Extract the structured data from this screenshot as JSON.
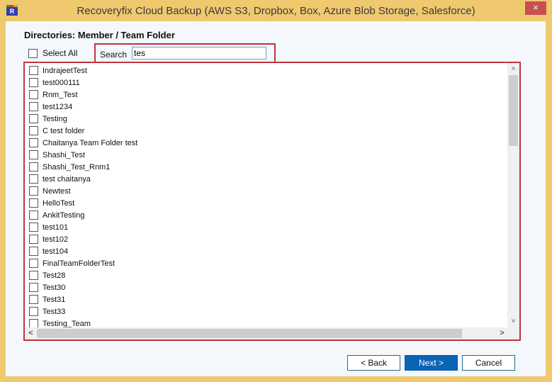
{
  "window": {
    "title": "Recoveryfix Cloud Backup (AWS S3, Dropbox, Box, Azure Blob Storage, Salesforce)",
    "app_icon_letter": "R",
    "close_glyph": "×"
  },
  "heading": "Directories: Member / Team Folder",
  "select_all": {
    "label": "Select All",
    "checked": false
  },
  "search": {
    "label": "Search",
    "value": "tes",
    "placeholder": ""
  },
  "items": [
    {
      "label": "IndrajeetTest",
      "checked": false
    },
    {
      "label": "test000111",
      "checked": false
    },
    {
      "label": "Rnm_Test",
      "checked": false
    },
    {
      "label": "test1234",
      "checked": false
    },
    {
      "label": "Testing",
      "checked": false
    },
    {
      "label": "C test folder",
      "checked": false
    },
    {
      "label": "Chaitanya Team Folder test",
      "checked": false
    },
    {
      "label": "Shashi_Test",
      "checked": false
    },
    {
      "label": "Shashi_Test_Rnm1",
      "checked": false
    },
    {
      "label": "test chaitanya",
      "checked": false
    },
    {
      "label": "Newtest",
      "checked": false
    },
    {
      "label": "HelloTest",
      "checked": false
    },
    {
      "label": "AnkitTesting",
      "checked": false
    },
    {
      "label": "test101",
      "checked": false
    },
    {
      "label": "test102",
      "checked": false
    },
    {
      "label": "test104",
      "checked": false
    },
    {
      "label": "FinalTeamFolderTest",
      "checked": false
    },
    {
      "label": "Test28",
      "checked": false
    },
    {
      "label": "Test30",
      "checked": false
    },
    {
      "label": "Test31",
      "checked": false
    },
    {
      "label": "Test33",
      "checked": false
    },
    {
      "label": "Testing_Team",
      "checked": false
    }
  ],
  "scroll": {
    "up_glyph": "˄",
    "down_glyph": "˅",
    "left_glyph": "<",
    "right_glyph": ">"
  },
  "buttons": {
    "back": "< Back",
    "next": "Next >",
    "cancel": "Cancel"
  },
  "colors": {
    "frame": "#f0c96e",
    "highlight": "#c0343f",
    "primary_button": "#0a64b4",
    "close_button": "#c75050"
  }
}
